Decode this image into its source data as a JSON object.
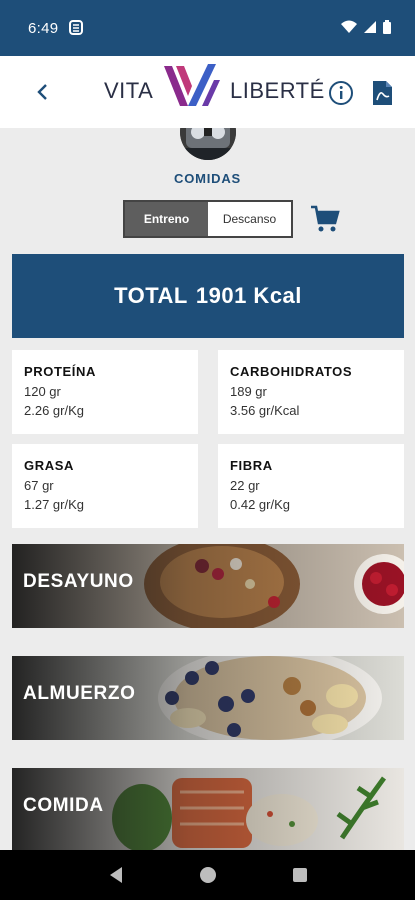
{
  "status": {
    "time": "6:49"
  },
  "header": {
    "logo_left": "VITA",
    "logo_right": "LIBERTÉ"
  },
  "section": {
    "title": "COMIDAS"
  },
  "toggle": {
    "active": "Entreno",
    "inactive": "Descanso"
  },
  "total": {
    "label": "TOTAL",
    "value": "1901 Kcal"
  },
  "macros": [
    {
      "title": "PROTEÍNA",
      "line1": "120 gr",
      "line2": "2.26 gr/Kg"
    },
    {
      "title": "CARBOHIDRATOS",
      "line1": "189 gr",
      "line2": "3.56 gr/Kcal"
    },
    {
      "title": "GRASA",
      "line1": "67 gr",
      "line2": "1.27 gr/Kg"
    },
    {
      "title": "FIBRA",
      "line1": "22 gr",
      "line2": "0.42 gr/Kg"
    }
  ],
  "meals": [
    {
      "label": "DESAYUNO"
    },
    {
      "label": "ALMUERZO"
    },
    {
      "label": "COMIDA"
    }
  ],
  "colors": {
    "brand_blue": "#1e4e79",
    "logo_purple": "#8a2a8c",
    "logo_blue": "#3c5fc6"
  }
}
